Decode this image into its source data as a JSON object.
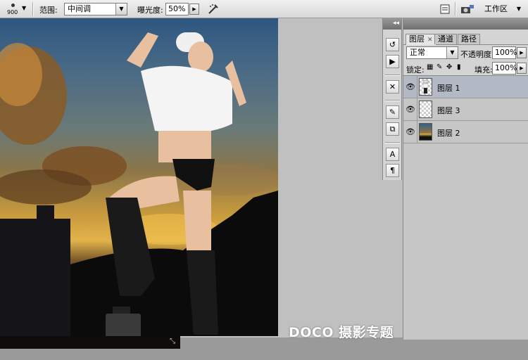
{
  "options_bar": {
    "brush_size": "900",
    "range_label": "范围:",
    "range_value": "中间调",
    "exposure_label": "曝光度:",
    "exposure_value": "50%",
    "workspace_label": "工作区"
  },
  "canvas": {
    "watermark": "DOCO 摄影专题"
  },
  "layers_panel": {
    "tabs": [
      {
        "label": "图层",
        "active": true
      },
      {
        "label": "通道",
        "active": false
      },
      {
        "label": "路径",
        "active": false
      }
    ],
    "blend_mode": "正常",
    "opacity_label": "不透明度:",
    "opacity_value": "100%",
    "lock_label": "锁定:",
    "fill_label": "填充:",
    "fill_value": "100%",
    "layers": [
      {
        "name": "图层 1",
        "selected": true,
        "thumb": "figure"
      },
      {
        "name": "图层 3",
        "selected": false,
        "thumb": "transparent"
      },
      {
        "name": "图层 2",
        "selected": false,
        "thumb": "photo"
      }
    ]
  },
  "colors": {
    "selected_layer_bg": "#b4b9c6",
    "panel_bg": "#d4d4d4"
  }
}
